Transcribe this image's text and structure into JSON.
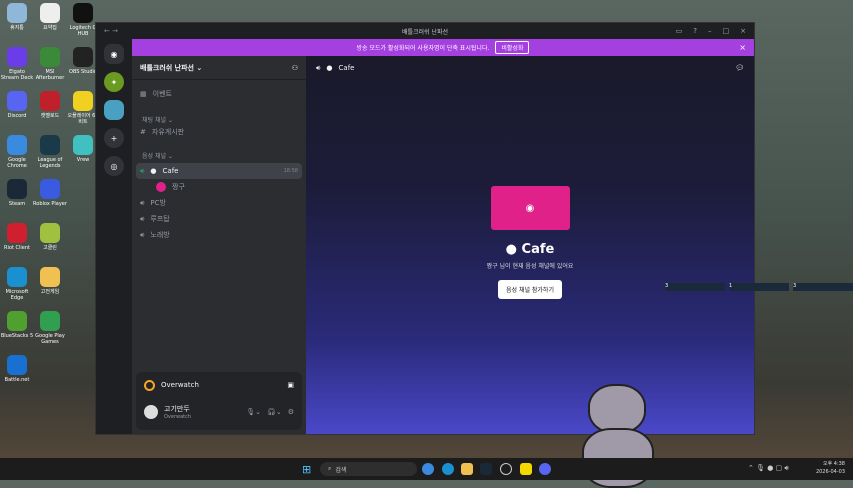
{
  "desktop": {
    "icons": [
      {
        "label": "휴지통",
        "color": "#8fb8d8"
      },
      {
        "label": "요약집",
        "color": "#eeeeee"
      },
      {
        "label": "Logitech G HUB",
        "color": "#111111"
      },
      {
        "label": "Elgato Stream Deck",
        "color": "#6a3de8"
      },
      {
        "label": "MSI Afterburner",
        "color": "#3a8a3a"
      },
      {
        "label": "OBS Studio",
        "color": "#222222"
      },
      {
        "label": "Discord",
        "color": "#5865f2"
      },
      {
        "label": "캣멜로드",
        "color": "#c0202a"
      },
      {
        "label": "오플레이어 64 비트",
        "color": "#f0d020"
      },
      {
        "label": "Google Chrome",
        "color": "#3a8ae0"
      },
      {
        "label": "League of Legends",
        "color": "#1a3a4a"
      },
      {
        "label": "Vrew",
        "color": "#40c0c0"
      },
      {
        "label": "Steam",
        "color": "#1b2838"
      },
      {
        "label": "Roblox Player",
        "color": "#3a5ae0"
      },
      {
        "label": "Riot Client",
        "color": "#d02030"
      },
      {
        "label": "고클린",
        "color": "#a0c040"
      },
      {
        "label": "Microsoft Edge",
        "color": "#1a90d0"
      },
      {
        "label": "고전게임",
        "color": "#f0c050"
      },
      {
        "label": "BlueStacks 5",
        "color": "#50a030"
      },
      {
        "label": "Google Play Games",
        "color": "#30a050"
      },
      {
        "label": "Battle.net",
        "color": "#1870d0"
      }
    ]
  },
  "window": {
    "title": "배틀크러쉬 난파선",
    "nav": "← →"
  },
  "banner": {
    "text": "방송 모드가 활성화되어 사용자명이 단축 표시됩니다.",
    "button": "비활성화",
    "close": "×"
  },
  "server": {
    "name": "배틀크러쉬 난파선 ⌄",
    "events": "이벤트",
    "text_category": "채팅 채널 ⌄",
    "text_channels": [
      "자유게시판"
    ],
    "voice_category": "음성 채널 ⌄",
    "voice_channels": [
      {
        "name": "Cafe",
        "time": "18:58",
        "members": [
          "짱구"
        ]
      },
      {
        "name": "PC방"
      },
      {
        "name": "루프탑"
      },
      {
        "name": "노래방"
      }
    ]
  },
  "activity": {
    "game": "Overwatch"
  },
  "user": {
    "name": "고기만두",
    "status": "Overwatch"
  },
  "main": {
    "channel": "Cafe",
    "title": "Cafe",
    "subtitle": "짱구 님이 현재 음성 채널에 있어요",
    "join": "음성 채널 참가하기"
  },
  "overlay": [
    "3",
    "1",
    "3"
  ],
  "taskbar": {
    "search": "검색",
    "time": "오후 4:38",
    "date": "2026-04-03"
  }
}
